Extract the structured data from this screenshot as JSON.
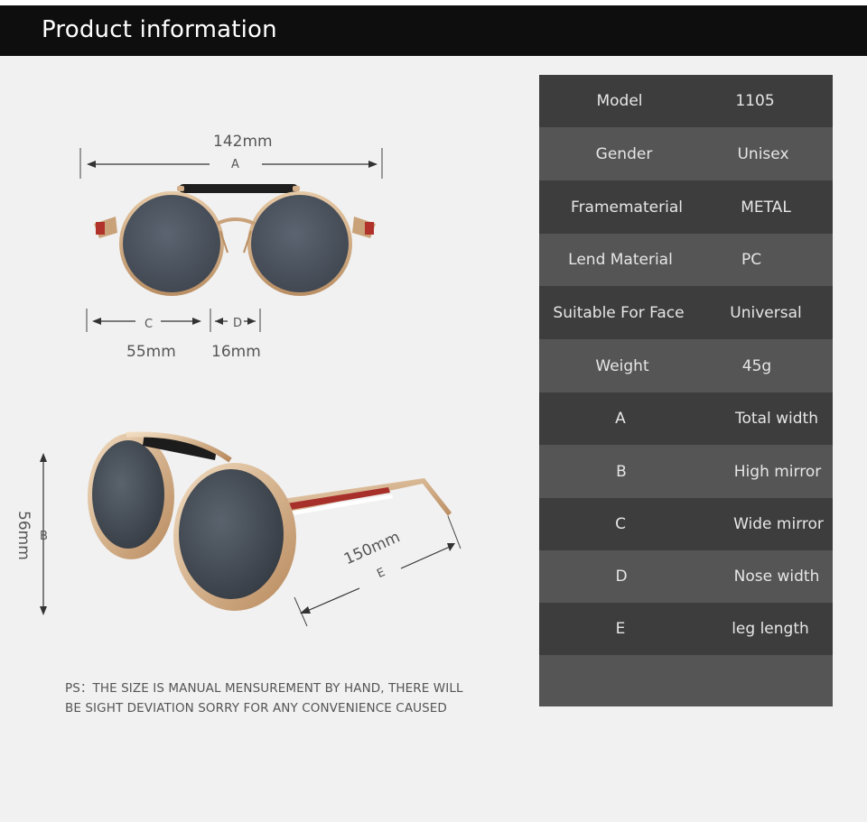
{
  "header": {
    "title": "Product information"
  },
  "diagram_front": {
    "total_width": "142mm",
    "total_width_letter": "A",
    "lens_width_letter": "C",
    "lens_width": "55mm",
    "nose_width_letter": "D",
    "nose_width": "16mm"
  },
  "diagram_side": {
    "height_value": "56mm",
    "height_letter": "B",
    "leg_length": "150mm",
    "leg_letter": "E"
  },
  "specs": [
    {
      "label": "Model",
      "value": "1105"
    },
    {
      "label": "Gender",
      "value": "Unisex"
    },
    {
      "label": "Framematerial",
      "value": "METAL"
    },
    {
      "label": "Lend Material",
      "value": "PC"
    },
    {
      "label": "Suitable For Face",
      "value": "Universal"
    },
    {
      "label": "Weight",
      "value": "45g"
    },
    {
      "label": "A",
      "value": "Total width"
    },
    {
      "label": "B",
      "value": "High mirror"
    },
    {
      "label": "C",
      "value": "Wide mirror"
    },
    {
      "label": "D",
      "value": "Nose width"
    },
    {
      "label": "E",
      "value": "leg length"
    }
  ],
  "note": {
    "line1": "PS：THE SIZE IS MANUAL MENSUREMENT BY HAND, THERE WILL",
    "line2": "BE SIGHT DEVIATION SORRY FOR ANY CONVENIENCE CAUSED"
  },
  "colors": {
    "header_bg": "#0e0e0e",
    "table_dark": "#3d3d3d",
    "table_light": "#555555",
    "lens": "#4b5563",
    "frame_gold": "#c9a27a"
  }
}
